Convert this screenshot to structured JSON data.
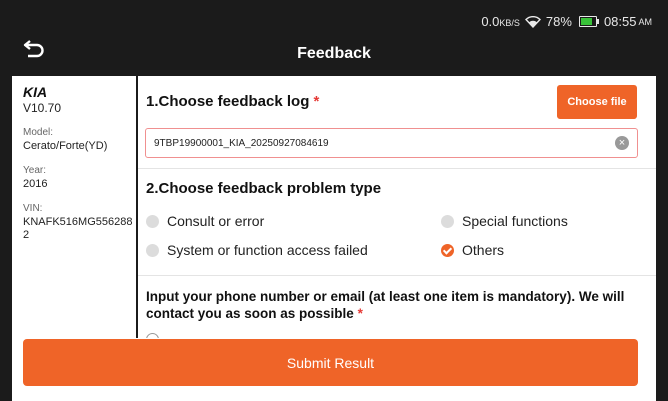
{
  "status": {
    "net_speed_value": "0.0",
    "net_speed_unit": "KB/S",
    "battery_text": "78%",
    "battery_level": 0.78,
    "time": "08:55",
    "ampm": "AM",
    "icons": [
      "wifi-icon",
      "battery-icon"
    ]
  },
  "header": {
    "title": "Feedback",
    "back_icon": "back-arrow-icon"
  },
  "vehicle": {
    "make": "KIA",
    "version": "V10.70",
    "model_label": "Model:",
    "model_value": "Cerato/Forte(YD)",
    "year_label": "Year:",
    "year_value": "2016",
    "vin_label": "VIN:",
    "vin_value": "KNAFK516MG5562882"
  },
  "section1": {
    "title": "1.Choose feedback log ",
    "required_mark": "*",
    "choose_file_label": "Choose file",
    "log_value": "9TBP19900001_KIA_20250927084619",
    "clear_icon": "clear-icon"
  },
  "section2": {
    "title": "2.Choose feedback problem type",
    "options": [
      {
        "label": "Consult or error",
        "selected": false
      },
      {
        "label": "Special functions",
        "selected": false
      },
      {
        "label": "System or function access failed",
        "selected": false
      },
      {
        "label": "Others",
        "selected": true
      }
    ]
  },
  "section3": {
    "title": "Input your phone number or email (at least one item is mandatory). We will contact you as soon as possible ",
    "required_mark": "*"
  },
  "submit_label": "Submit Result",
  "colors": {
    "accent": "#ef6428",
    "required": "#e53935",
    "topbar": "#1b1b1b"
  }
}
